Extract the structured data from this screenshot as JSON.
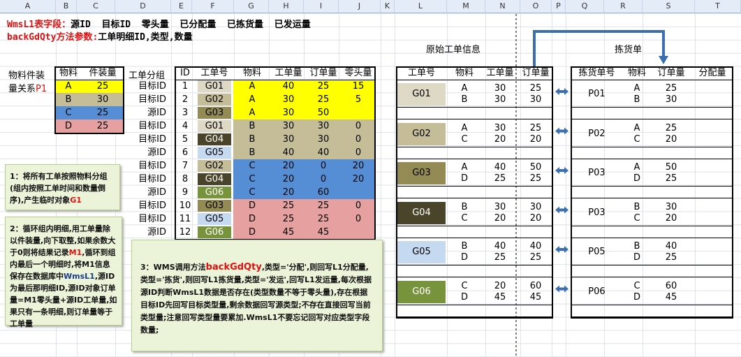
{
  "columns": [
    "A",
    "B",
    "C",
    "D",
    "E",
    "F",
    "G",
    "H",
    "I",
    "J",
    "K",
    "L",
    "M",
    "N",
    "O",
    "P",
    "Q",
    "R",
    "S",
    "T"
  ],
  "title": {
    "line1_red": "WmsL1表字段：",
    "line1_rest": "源ID  目标ID  零头量  已分配量  已拣货量  已发运量",
    "line2_red": "backGdQty方法参数:",
    "line2_rest": "工单明细ID,类型,数量"
  },
  "material_table": {
    "label_line1": "物料件装",
    "label_line2_a": "量关系",
    "label_line2_b": "P1",
    "headers": [
      "物料",
      "件装量"
    ],
    "rows": [
      {
        "material": "A",
        "qty": "25",
        "color": "#ffff00"
      },
      {
        "material": "B",
        "qty": "30",
        "color": "#c4bd97"
      },
      {
        "material": "C",
        "qty": "25",
        "color": "#558ed5"
      },
      {
        "material": "D",
        "qty": "25",
        "color": "#e6a0a0"
      }
    ]
  },
  "group_label": "工单分组",
  "main_table": {
    "headers": [
      "ID",
      "工单号",
      "物料",
      "工单量",
      "订单量",
      "零头量"
    ],
    "rows": [
      {
        "group": "目标ID",
        "id": "1",
        "wo": "G01",
        "mat": "A",
        "wq": "40",
        "oq": "25",
        "lq": "15"
      },
      {
        "group": "目标ID",
        "id": "2",
        "wo": "G02",
        "mat": "A",
        "wq": "30",
        "oq": "25",
        "lq": "5"
      },
      {
        "group": "源ID",
        "id": "3",
        "wo": "G03",
        "mat": "A",
        "wq": "30",
        "oq": "50",
        "lq": ""
      },
      {
        "group": "目标ID",
        "id": "4",
        "wo": "G01",
        "mat": "B",
        "wq": "30",
        "oq": "30",
        "lq": "0"
      },
      {
        "group": "目标ID",
        "id": "5",
        "wo": "G04",
        "mat": "B",
        "wq": "30",
        "oq": "30",
        "lq": "0"
      },
      {
        "group": "源ID",
        "id": "6",
        "wo": "G05",
        "mat": "B",
        "wq": "40",
        "oq": "40",
        "lq": "0"
      },
      {
        "group": "目标ID",
        "id": "7",
        "wo": "G02",
        "mat": "C",
        "wq": "20",
        "oq": "0",
        "lq": "20"
      },
      {
        "group": "目标ID",
        "id": "8",
        "wo": "G04",
        "mat": "C",
        "wq": "20",
        "oq": "0",
        "lq": "20"
      },
      {
        "group": "源ID",
        "id": "9",
        "wo": "G06",
        "mat": "C",
        "wq": "20",
        "oq": "60",
        "lq": ""
      },
      {
        "group": "目标ID",
        "id": "10",
        "wo": "G03",
        "mat": "D",
        "wq": "25",
        "oq": "25",
        "lq": "0"
      },
      {
        "group": "目标ID",
        "id": "11",
        "wo": "G05",
        "mat": "D",
        "wq": "25",
        "oq": "25",
        "lq": "0"
      },
      {
        "group": "源ID",
        "id": "12",
        "wo": "G06",
        "mat": "D",
        "wq": "45",
        "oq": "45",
        "lq": ""
      }
    ]
  },
  "wo_colors": {
    "G01": "#ddd9c4",
    "G02": "#c4bd97",
    "G03": "#948a54",
    "G04": "#4a452a",
    "G05": "#c5d9f1",
    "G06": "#77933c"
  },
  "wo_text_colors": {
    "G01": "#000",
    "G02": "#000",
    "G03": "#000",
    "G04": "#fff",
    "G05": "#000",
    "G06": "#fff"
  },
  "section_titles": {
    "original": "原始工单信息",
    "picking": "拣货单"
  },
  "original_table": {
    "headers": [
      "工单号",
      "物料",
      "工单量",
      "订单量"
    ],
    "groups": [
      {
        "wo": "G01",
        "lines": [
          [
            "A",
            "30",
            "25"
          ],
          [
            "B",
            "30",
            "30"
          ]
        ]
      },
      {
        "wo": "G02",
        "lines": [
          [
            "A",
            "30",
            "25"
          ],
          [
            "C",
            "20",
            "20"
          ]
        ]
      },
      {
        "wo": "G03",
        "lines": [
          [
            "A",
            "40",
            "50"
          ],
          [
            "D",
            "25",
            "25"
          ]
        ]
      },
      {
        "wo": "G04",
        "lines": [
          [
            "B",
            "30",
            "30"
          ],
          [
            "C",
            "20",
            "20"
          ]
        ]
      },
      {
        "wo": "G05",
        "lines": [
          [
            "B",
            "40",
            "40"
          ],
          [
            "D",
            "25",
            "25"
          ]
        ]
      },
      {
        "wo": "G06",
        "lines": [
          [
            "C",
            "20",
            "60"
          ],
          [
            "D",
            "45",
            "45"
          ]
        ]
      }
    ]
  },
  "picking_table": {
    "headers": [
      "拣货单号",
      "物料",
      "订单量",
      "分配量"
    ],
    "groups": [
      {
        "no": "P01",
        "lines": [
          [
            "A",
            "25"
          ],
          [
            "B",
            "30"
          ]
        ]
      },
      {
        "no": "P02",
        "lines": [
          [
            "A",
            "25"
          ],
          [
            "C",
            "20"
          ]
        ]
      },
      {
        "no": "P03",
        "lines": [
          [
            "A",
            "50"
          ],
          [
            "D",
            "25"
          ]
        ]
      },
      {
        "no": "P03",
        "lines": [
          [
            "B",
            "30"
          ],
          [
            "C",
            "20"
          ]
        ]
      },
      {
        "no": "P05",
        "lines": [
          [
            "B",
            "40"
          ],
          [
            "D",
            "25"
          ]
        ]
      },
      {
        "no": "P06",
        "lines": [
          [
            "C",
            "60"
          ],
          [
            "D",
            "45"
          ]
        ]
      }
    ]
  },
  "notes": {
    "note1": {
      "text": "1：将所有工单按照物料分组(组内按照工单时间和数量倒序),产生临时对象",
      "red": "G1"
    },
    "note2": {
      "parts": [
        "2：循环组内明细,用工单量除以件装量,向下取整,如果余数大于0则将结果记录",
        "M1",
        ",循环到组内最后一个明细时,将M1信息保存在数据库中",
        "WmsL1",
        ",源ID为最后那明细ID,源ID对象订单量=M1零头量+源ID工单量,如果只有一条明细,则订单量等于工单量"
      ]
    },
    "note3": {
      "parts": [
        "3：WMS调用方法",
        "backGdQty",
        ",类型='分配',则回写L1分配量,类型='拣货',则回写L1拣货量,类型='发运',回写L1发运量,每次根据源ID判断WmsL1数据是否存在(类型数量不等于零头量),存在根据目标ID先回写目标类型量,剩余数据回写源类型;不存在直接回写当前类型量;注意回写类型量要累加.WmsL1不要忘记回写对应类型字段数量;"
      ]
    }
  }
}
